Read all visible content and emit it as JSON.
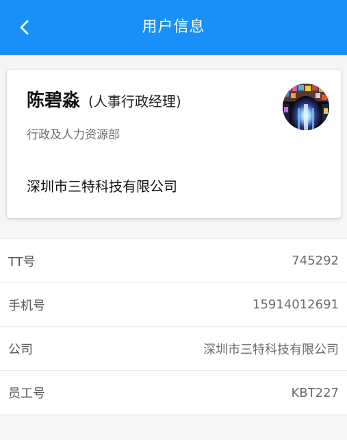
{
  "header": {
    "title": "用户信息",
    "back_icon": "chevron-left-icon",
    "background": "#1890f7"
  },
  "profile": {
    "name": "陈碧淼",
    "position": "(人事行政经理)",
    "department": "行政及人力资源部",
    "company": "深圳市三特科技有限公司",
    "avatar_icon": "avatar-image"
  },
  "details": [
    {
      "label": "TT号",
      "value": "745292"
    },
    {
      "label": "手机号",
      "value": "15914012691"
    },
    {
      "label": "公司",
      "value": "深圳市三特科技有限公司"
    },
    {
      "label": "员工号",
      "value": "KBT227"
    }
  ]
}
